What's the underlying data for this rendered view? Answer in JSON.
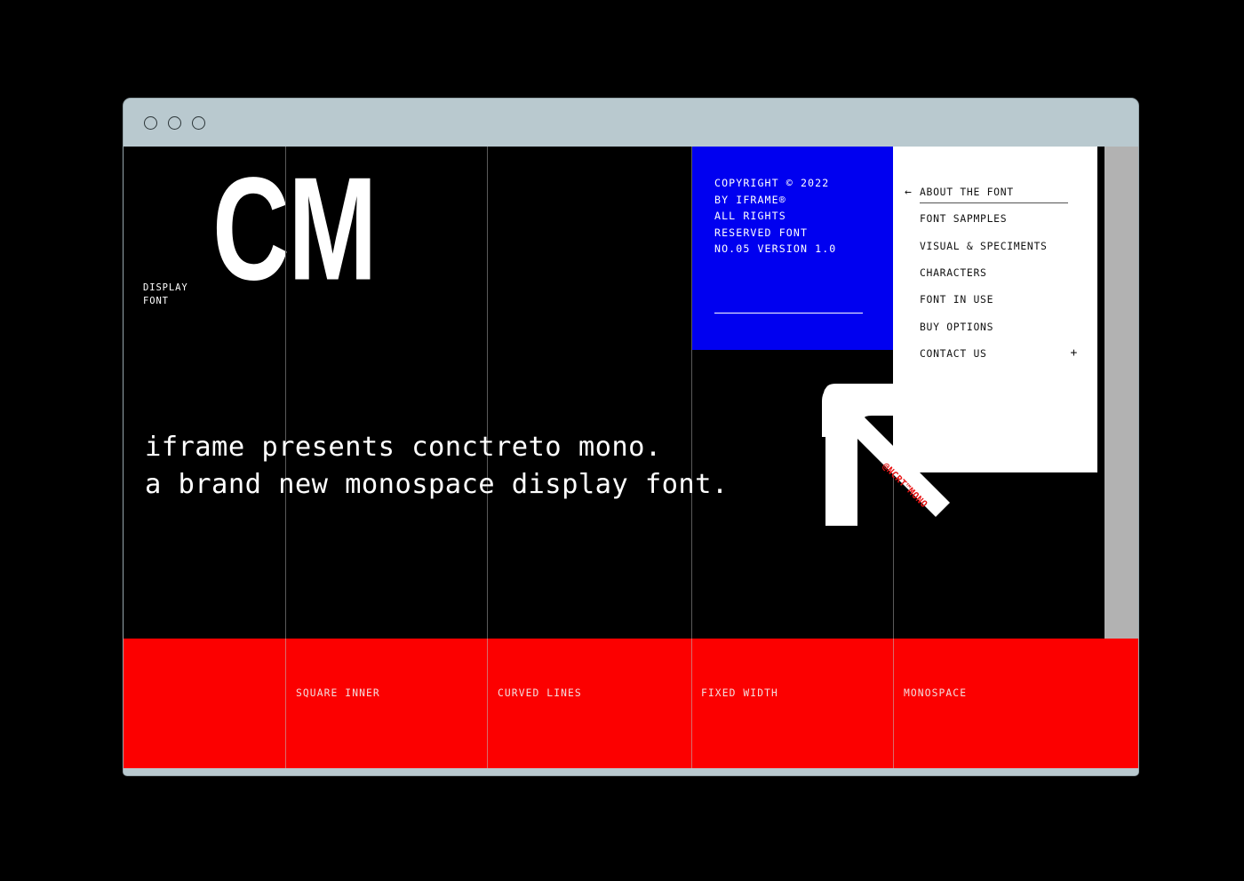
{
  "window": {
    "traffic_lights": [
      "close",
      "minimize",
      "maximize"
    ]
  },
  "hero": {
    "display_label": "DISPLAY\nFONT",
    "wordmark": "CM"
  },
  "headline": {
    "line1": "iframe presents conctreto mono.",
    "line2": "a brand new monospace display font."
  },
  "copyright": {
    "text": "COPYRIGHT © 2022\nBY IFRAME®\nALL RIGHTS\nRESERVED FONT\nNO.05 VERSION 1.0"
  },
  "menu": {
    "items": [
      {
        "label": "ABOUT THE FONT",
        "leading_icon": "arrow-left-icon",
        "trailing_icon": "",
        "active": true
      },
      {
        "label": "FONT SAPMPLES",
        "leading_icon": "",
        "trailing_icon": "",
        "active": false
      },
      {
        "label": "VISUAL & SPECIMENTS",
        "leading_icon": "",
        "trailing_icon": "",
        "active": false
      },
      {
        "label": "CHARACTERS",
        "leading_icon": "",
        "trailing_icon": "",
        "active": false
      },
      {
        "label": "FONT IN USE",
        "leading_icon": "",
        "trailing_icon": "",
        "active": false
      },
      {
        "label": "BUY OPTIONS",
        "leading_icon": "",
        "trailing_icon": "",
        "active": false
      },
      {
        "label": "CONTACT US",
        "leading_icon": "",
        "trailing_icon": "plus-icon",
        "active": false
      }
    ],
    "back_arrow_glyph": "←",
    "plus_glyph": "+"
  },
  "arrow": {
    "tag_text": "@NCRT™MONO",
    "icon": "arrow-up-left-icon"
  },
  "features": [
    {
      "label": "SQUARE INNER"
    },
    {
      "label": "CURVED LINES"
    },
    {
      "label": "FIXED WIDTH"
    },
    {
      "label": "MONOSPACE"
    }
  ],
  "colors": {
    "page_background": "#000000",
    "chrome": "#b9c9cf",
    "accent_blue": "#0000f0",
    "accent_red": "#fc0000",
    "panel_white": "#ffffff",
    "scrollbar": "#b2b2b2",
    "tag_red": "#e81414"
  }
}
